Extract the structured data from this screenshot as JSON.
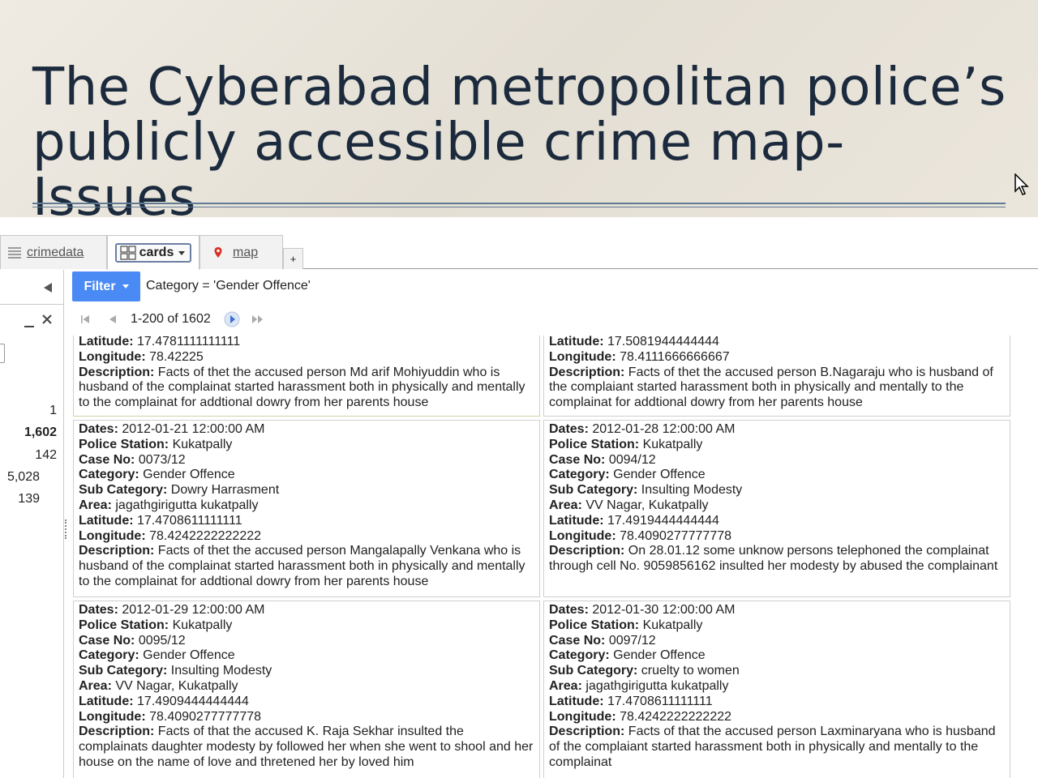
{
  "slide": {
    "title_line1": "The Cyberabad metropolitan police’s",
    "title_line2": "publicly accessible crime map- Issues"
  },
  "tabs": {
    "crimedata": "crimedata",
    "cards": "cards",
    "map": "map",
    "add": "+"
  },
  "filter": {
    "button_label": "Filter",
    "expression": "Category = 'Gender Offence'"
  },
  "pager": {
    "range": "1-200 of 1602"
  },
  "sidebar": {
    "values": [
      "1",
      "1,602",
      "142",
      "5,028",
      "139"
    ]
  },
  "labels": {
    "dates": "Dates:",
    "station": "Police Station:",
    "case": "Case No:",
    "category": "Category:",
    "subcategory": "Sub Category:",
    "area": "Area:",
    "lat": "Latitude:",
    "lon": "Longitude:",
    "desc": "Description:"
  },
  "cards": [
    {
      "lat": "17.4781111111111",
      "lon": "78.42225",
      "desc": "Facts of thet the accused person Md arif Mohiyuddin who is husband of the complainat started harassment both in physically and mentally to the complainat for addtional dowry from her parents house"
    },
    {
      "lat": "17.5081944444444",
      "lon": "78.4111666666667",
      "desc": "Facts of thet the accused person B.Nagaraju who is husband of the complaiant started harassment both in physically and mentally to the complainat for addtional dowry from her parents house"
    },
    {
      "dates": "2012-01-21 12:00:00 AM",
      "station": "Kukatpally",
      "case": "0073/12",
      "category": "Gender Offence",
      "subcategory": "Dowry Harrasment",
      "area": "jagathgirigutta kukatpally",
      "lat": "17.4708611111111",
      "lon": "78.4242222222222",
      "desc": "Facts of thet the accused person Mangalapally Venkana who is husband of the complainat started harassment both in physically and mentally to the complainat for addtional dowry from her parents house"
    },
    {
      "dates": "2012-01-28 12:00:00 AM",
      "station": "Kukatpally",
      "case": "0094/12",
      "category": "Gender Offence",
      "subcategory": "Insulting Modesty",
      "area": "VV Nagar, Kukatpally",
      "lat": "17.4919444444444",
      "lon": "78.4090277777778",
      "desc": "On 28.01.12 some unknow persons telephoned the complainat through cell No. 9059856162 insulted her modesty by abused the complainant"
    },
    {
      "dates": "2012-01-29 12:00:00 AM",
      "station": "Kukatpally",
      "case": "0095/12",
      "category": "Gender Offence",
      "subcategory": "Insulting Modesty",
      "area": "VV Nagar, Kukatpally",
      "lat": "17.4909444444444",
      "lon": "78.4090277777778",
      "desc": "Facts of that the accused K. Raja Sekhar insulted the complainats daughter modesty by followed her when she went to shool and her house on the name of love and thretened her by loved him"
    },
    {
      "dates": "2012-01-30 12:00:00 AM",
      "station": "Kukatpally",
      "case": "0097/12",
      "category": "Gender Offence",
      "subcategory": "cruelty to women",
      "area": "jagathgirigutta kukatpally",
      "lat": "17.4708611111111",
      "lon": "78.4242222222222",
      "desc": "Facts of that the accused person Laxminaryana who is husband of the complaiant started harassment both in physically and mentally to the complainat"
    }
  ]
}
